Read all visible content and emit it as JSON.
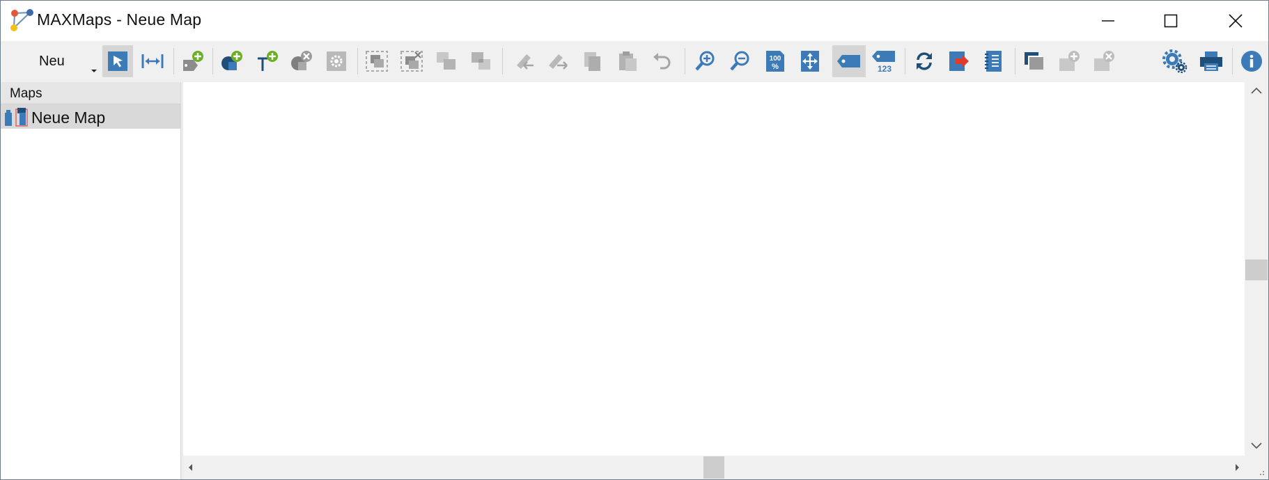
{
  "window": {
    "title": "MAXMaps - Neue Map",
    "controls": [
      "minimize-icon",
      "maximize-icon",
      "close-icon"
    ]
  },
  "toolbar": {
    "new_label": "Neu",
    "buttons": [
      {
        "name": "select-pointer-icon",
        "active": true
      },
      {
        "name": "connect-arrows-icon",
        "active": false
      },
      {
        "name": "add-tag-object-icon",
        "active": false
      },
      {
        "name": "add-shape-icon",
        "active": false
      },
      {
        "name": "add-text-icon",
        "active": false
      },
      {
        "name": "delete-object-icon",
        "active": false
      },
      {
        "name": "object-settings-icon",
        "active": false
      },
      {
        "name": "group-icon",
        "active": false
      },
      {
        "name": "ungroup-icon",
        "active": false
      },
      {
        "name": "bring-forward-icon",
        "active": false
      },
      {
        "name": "send-backward-icon",
        "active": false
      },
      {
        "name": "link-back-icon",
        "active": false
      },
      {
        "name": "link-forward-icon",
        "active": false
      },
      {
        "name": "copy-icon",
        "active": false
      },
      {
        "name": "paste-icon",
        "active": false
      },
      {
        "name": "undo-icon",
        "active": false
      },
      {
        "name": "zoom-in-icon",
        "active": false
      },
      {
        "name": "zoom-out-icon",
        "active": false
      },
      {
        "name": "zoom-100-icon",
        "active": false
      },
      {
        "name": "fit-to-window-icon",
        "active": false
      },
      {
        "name": "show-labels-icon",
        "active": true
      },
      {
        "name": "show-numbers-icon",
        "active": false
      },
      {
        "name": "refresh-icon",
        "active": false
      },
      {
        "name": "export-icon",
        "active": false
      },
      {
        "name": "memo-icon",
        "active": false
      },
      {
        "name": "layers-icon",
        "active": false
      },
      {
        "name": "add-layer-icon",
        "active": false
      },
      {
        "name": "delete-layer-icon",
        "active": false
      },
      {
        "name": "settings-icon",
        "active": false
      },
      {
        "name": "print-icon",
        "active": false
      },
      {
        "name": "info-icon",
        "active": false
      }
    ],
    "zoom_100_text": "100 %",
    "numbers_text": "123"
  },
  "sidebar": {
    "header": "Maps",
    "items": [
      {
        "label": "Neue Map",
        "selected": true
      }
    ]
  },
  "colors": {
    "accent_blue": "#3d7ab8",
    "dark_blue": "#1f4e79",
    "green_plus": "#6ab023",
    "disabled_gray": "#b9b9b9",
    "red_export": "#e03a2f"
  }
}
